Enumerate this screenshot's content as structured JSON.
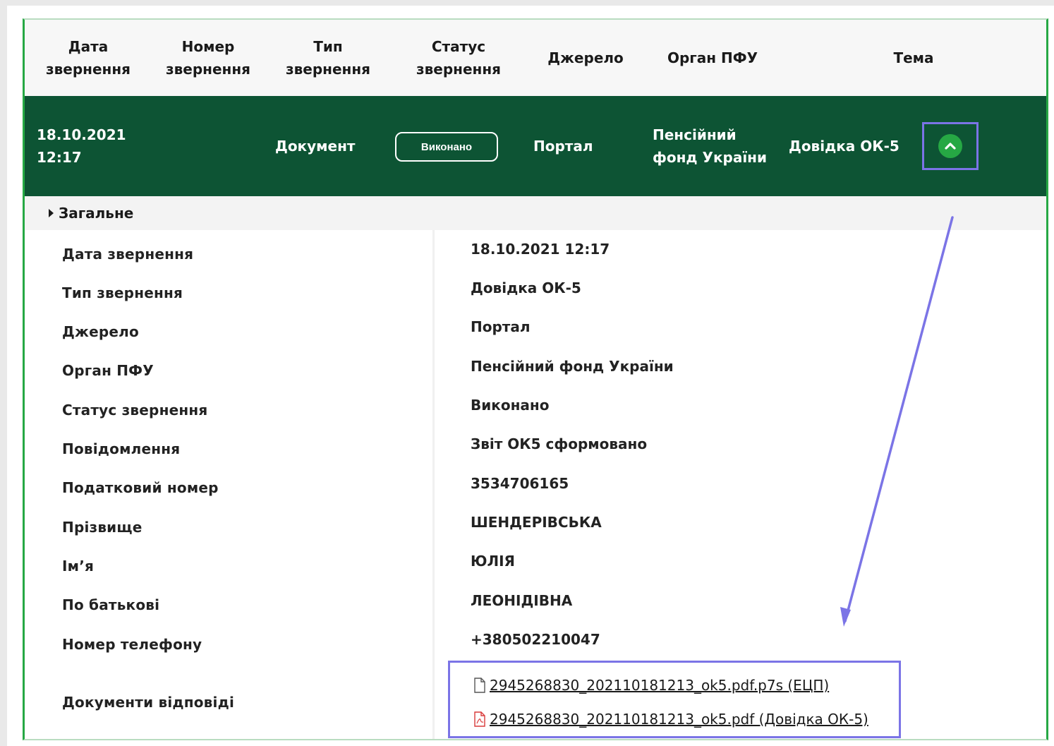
{
  "table": {
    "headers": [
      "Дата\nзвернення",
      "Номер\nзвернення",
      "Тип\nзвернення",
      "Статус\nзвернення",
      "Джерело",
      "Орган ПФУ",
      "Тема"
    ]
  },
  "row": {
    "date": "18.10.2021\n12:17",
    "type": "Документ",
    "status": "Виконано",
    "source": "Портал",
    "organ": "Пенсійний\nфонд України",
    "topic": "Довідка ОК-5"
  },
  "section": {
    "title": "Загальне"
  },
  "details": [
    {
      "label": "Дата звернення",
      "value": "18.10.2021 12:17"
    },
    {
      "label": "Тип звернення",
      "value": "Довідка ОК-5"
    },
    {
      "label": "Джерело",
      "value": "Портал"
    },
    {
      "label": "Орган ПФУ",
      "value": "Пенсійний фонд України"
    },
    {
      "label": "Статус звернення",
      "value": "Виконано"
    },
    {
      "label": "Повідомлення",
      "value": "Звіт ОК5 сформовано"
    },
    {
      "label": "Податковий номер",
      "value": "3534706165"
    },
    {
      "label": "Прізвище",
      "value": "ШЕНДЕРІВСЬКА"
    },
    {
      "label": "Ім’я",
      "value": "ЮЛІЯ"
    },
    {
      "label": "По батькові",
      "value": "ЛЕОНІДІВНА"
    },
    {
      "label": "Номер телефону",
      "value": "+380502210047"
    }
  ],
  "documents": {
    "label": "Документи відповіді",
    "files": [
      {
        "name": "2945268830_202110181213_ok5.pdf.p7s (ЕЦП)",
        "icon": "file-icon"
      },
      {
        "name": "2945268830_202110181213_ok5.pdf (Довідка ОК-5)",
        "icon": "pdf-icon"
      }
    ]
  },
  "colors": {
    "row_bg": "#0d5434",
    "accent_green": "#26a844",
    "highlight": "#7b74e6"
  }
}
